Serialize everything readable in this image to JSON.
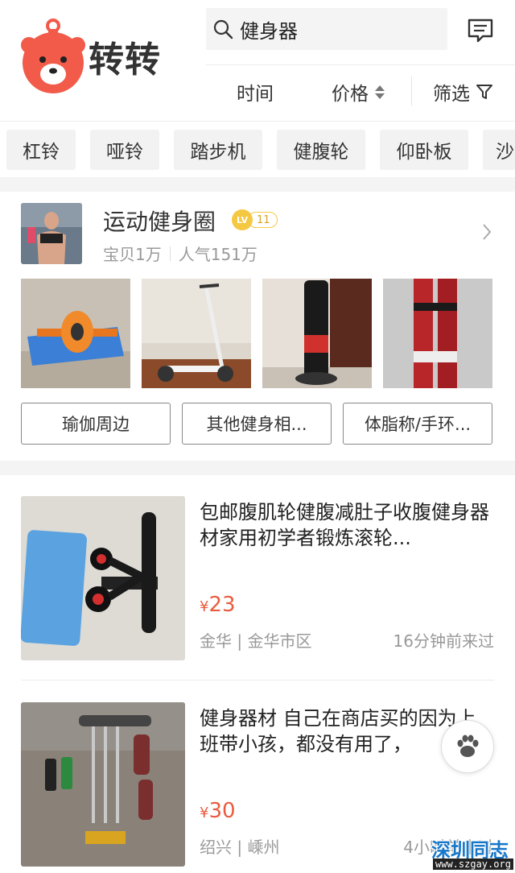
{
  "app": {
    "logo_text": "转转",
    "brand_color": "#f25a4a"
  },
  "search": {
    "query": "健身器",
    "icon": "search-icon"
  },
  "header": {
    "message_icon": "message-icon"
  },
  "sort_bar": {
    "time": "时间",
    "price": "价格",
    "filter": "筛选"
  },
  "chips": [
    "杠铃",
    "哑铃",
    "踏步机",
    "健腹轮",
    "仰卧板",
    "沙"
  ],
  "circle": {
    "name": "运动健身圈",
    "level_prefix": "LV",
    "level": "11",
    "items_label": "宝贝1万",
    "popularity_label": "人气151万",
    "sub_tags": [
      "瑜伽周边",
      "其他健身相...",
      "体脂称/手环..."
    ]
  },
  "products": [
    {
      "title": "包邮腹肌轮健腹减肚子收腹健身器材家用初学者锻炼滚轮...",
      "currency": "¥",
      "price": "23",
      "location": "金华 | 金华市区",
      "time": "16分钟前来过"
    },
    {
      "title": "健身器材 自己在商店买的因为上班带小孩，都没有用了，",
      "currency": "¥",
      "price": "30",
      "location": "绍兴 | 嵊州",
      "time": "4小时前来过"
    }
  ],
  "watermark": {
    "text": "深圳同志",
    "url": "www.szgay.org"
  },
  "colors": {
    "price": "#e85c3f",
    "level_badge": "#f5c842",
    "watermark": "#1877c9"
  }
}
